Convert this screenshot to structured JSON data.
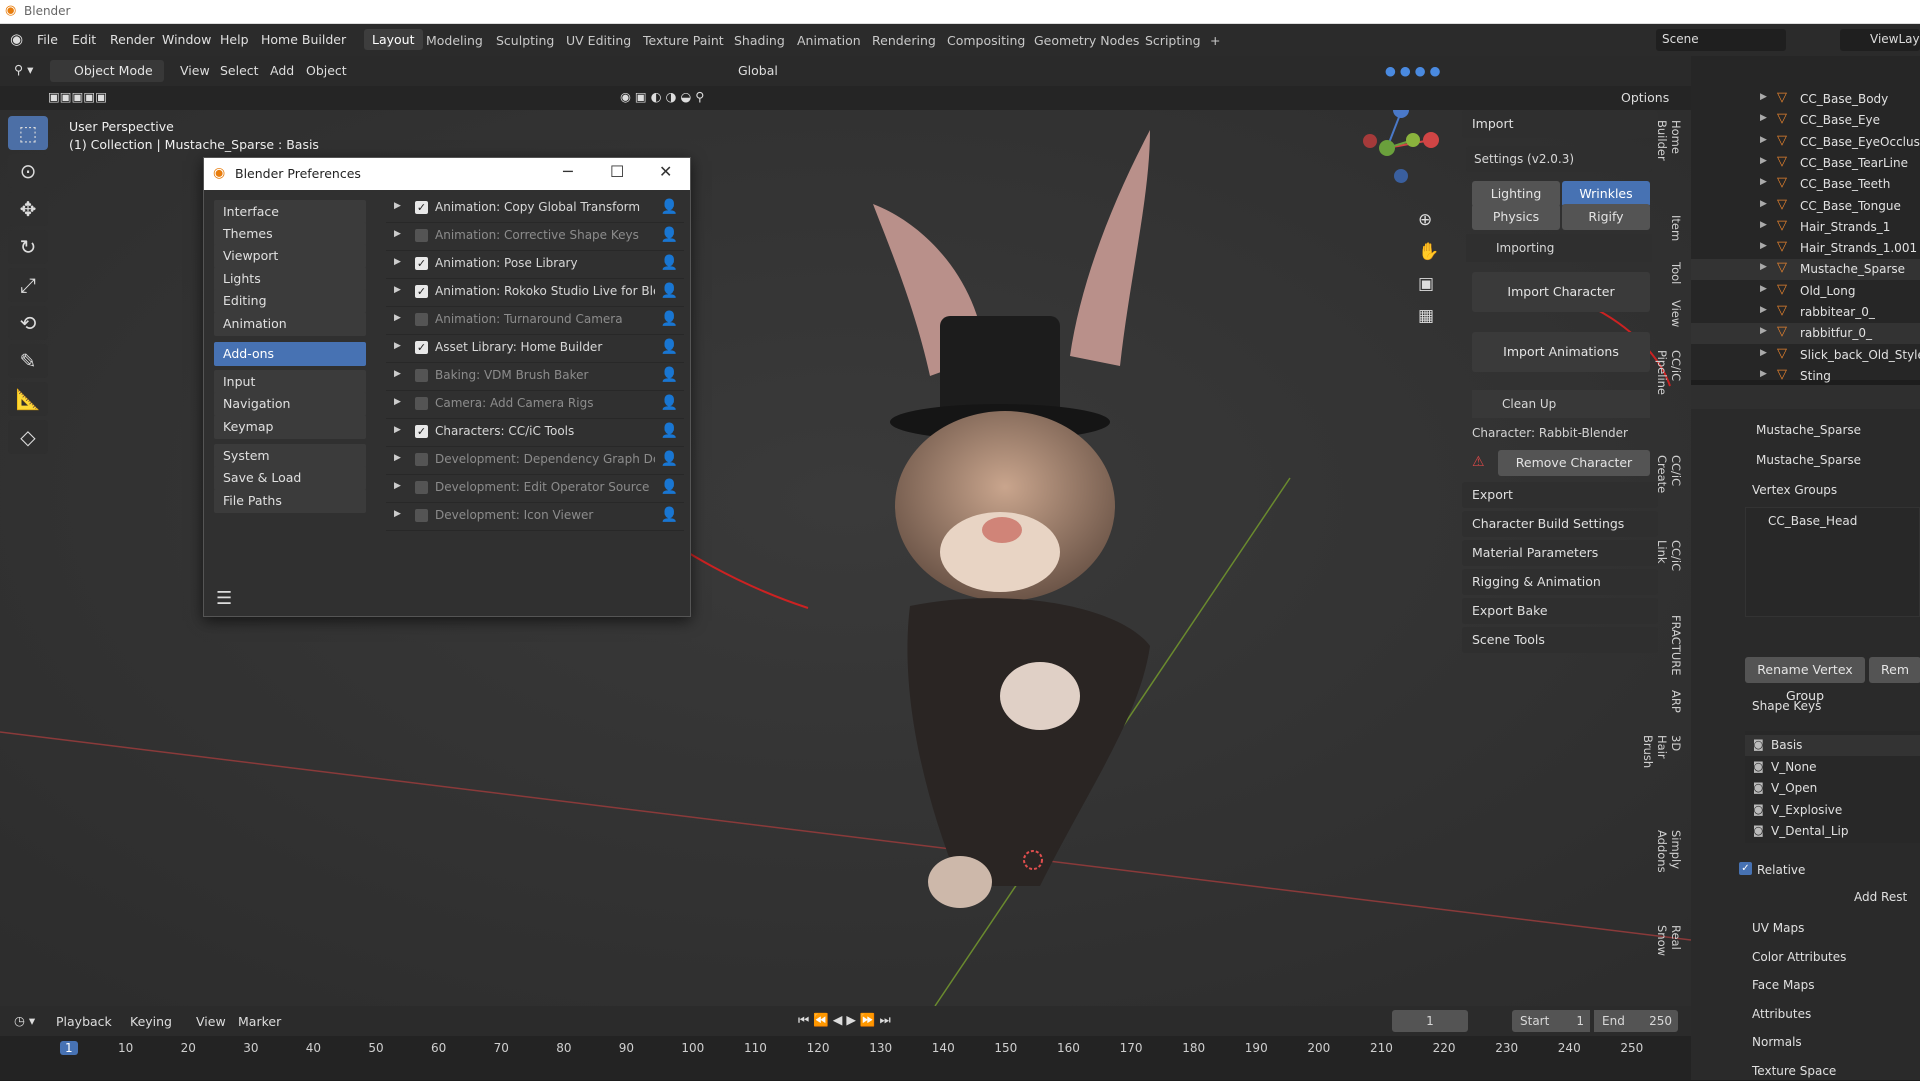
{
  "app": {
    "title": "Blender"
  },
  "menu": [
    "File",
    "Edit",
    "Render",
    "Window",
    "Help",
    "Home Builder"
  ],
  "workspaces": [
    "Layout",
    "Modeling",
    "Sculpting",
    "UV Editing",
    "Texture Paint",
    "Shading",
    "Animation",
    "Rendering",
    "Compositing",
    "Geometry Nodes",
    "Scripting"
  ],
  "scene": {
    "label": "Scene",
    "view_layer": "ViewLayer"
  },
  "viewport_header": {
    "mode": "Object Mode",
    "menus": [
      "View",
      "Select",
      "Add",
      "Object"
    ],
    "orientation": "Global",
    "options": "Options"
  },
  "viewport": {
    "perspective": "User Perspective",
    "collection": "(1) Collection | Mustache_Sparse : Basis"
  },
  "preferences": {
    "title": "Blender Preferences",
    "categories": [
      "Interface",
      "Themes",
      "Viewport",
      "Lights",
      "Editing",
      "Animation",
      "Add-ons",
      "Input",
      "Navigation",
      "Keymap",
      "System",
      "Save & Load",
      "File Paths"
    ],
    "selected": "Add-ons",
    "addons": [
      {
        "name": "Animation: Copy Global Transform",
        "enabled": true
      },
      {
        "name": "Animation: Corrective Shape Keys",
        "enabled": false
      },
      {
        "name": "Animation: Pose Library",
        "enabled": true
      },
      {
        "name": "Animation: Rokoko Studio Live for Ble...",
        "enabled": true
      },
      {
        "name": "Animation: Turnaround Camera",
        "enabled": false
      },
      {
        "name": "Asset Library: Home Builder",
        "enabled": true
      },
      {
        "name": "Baking: VDM Brush Baker",
        "enabled": false
      },
      {
        "name": "Camera: Add Camera Rigs",
        "enabled": false
      },
      {
        "name": "Characters: CC/iC Tools",
        "enabled": true
      },
      {
        "name": "Development: Dependency Graph Debug",
        "enabled": false
      },
      {
        "name": "Development: Edit Operator Source",
        "enabled": false
      },
      {
        "name": "Development: Icon Viewer",
        "enabled": false
      }
    ]
  },
  "cc_panel": {
    "import": "Import",
    "settings": "Settings  (v2.0.3)",
    "tabs": [
      "Lighting",
      "Wrinkles",
      "Physics",
      "Rigify"
    ],
    "importing": "Importing",
    "import_character": "Import Character",
    "import_animations": "Import Animations",
    "clean_up": "Clean Up",
    "character": "Character: Rabbit-Blender",
    "remove_character": "Remove Character",
    "sections": [
      "Export",
      "Character Build Settings",
      "Material Parameters",
      "Rigging & Animation",
      "Export Bake",
      "Scene Tools"
    ]
  },
  "side_tabs": [
    "Home Builder",
    "Item",
    "Tool",
    "View",
    "CC/iC Pipeline",
    "CC/iC Create",
    "CC/iC Link",
    "FRACTURE",
    "ARP",
    "3D Hair Brush",
    "Simply Addons",
    "Real Snow"
  ],
  "outliner": [
    "CC_Base_Body",
    "CC_Base_Eye",
    "CC_Base_EyeOcclusion",
    "CC_Base_TearLine",
    "CC_Base_Teeth",
    "CC_Base_Tongue",
    "Hair_Strands_1",
    "Hair_Strands_1.001",
    "Mustache_Sparse",
    "Old_Long",
    "rabbitear_0_",
    "rabbitfur_0_",
    "Slick_back_Old_Style",
    "Sting"
  ],
  "properties": {
    "breadcrumb": "Mustache_Sparse",
    "mesh_name": "Mustache_Sparse",
    "vertex_groups": "Vertex Groups",
    "vg_item": "CC_Base_Head",
    "rename_vg": "Rename Vertex Group",
    "rem": "Rem",
    "shape_keys": "Shape Keys",
    "keys": [
      "Basis",
      "V_None",
      "V_Open",
      "V_Explosive",
      "V_Dental_Lip"
    ],
    "relative": "Relative",
    "add_rest": "Add Rest",
    "sections": [
      "UV Maps",
      "Color Attributes",
      "Face Maps",
      "Attributes",
      "Normals",
      "Texture Space"
    ]
  },
  "timeline": {
    "menus": [
      "Playback",
      "Keying",
      "View",
      "Marker"
    ],
    "current_frame": "1",
    "start_label": "Start",
    "start": "1",
    "end_label": "End",
    "end": "250",
    "ticks": [
      "1",
      "10",
      "20",
      "30",
      "40",
      "50",
      "60",
      "70",
      "80",
      "90",
      "100",
      "110",
      "120",
      "130",
      "140",
      "150",
      "160",
      "170",
      "180",
      "190",
      "200",
      "210",
      "220",
      "230",
      "240",
      "250"
    ]
  }
}
